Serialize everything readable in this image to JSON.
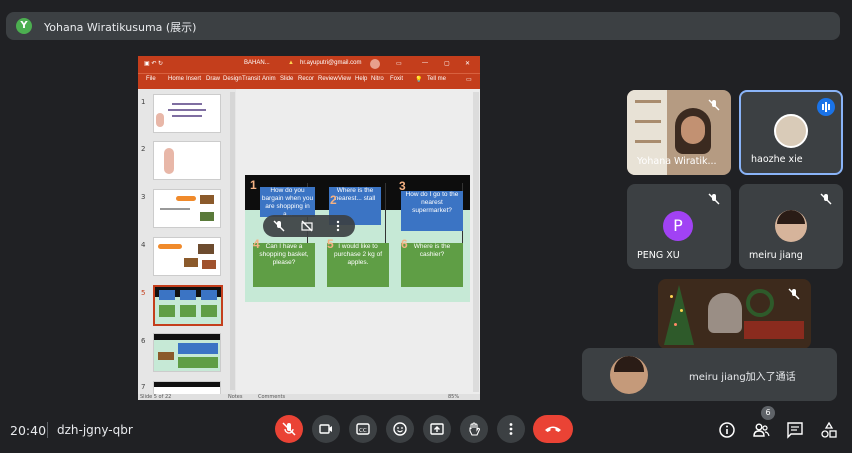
{
  "presenter_bar": {
    "avatar_initial": "Y",
    "name": "Yohana Wiratikusuma (展示)"
  },
  "shared_window": {
    "title_text": "BAHAN...",
    "account": "hr.ayuputri@gmail.com",
    "menu": [
      "File",
      "Home",
      "Insert",
      "Draw",
      "Design",
      "Transit",
      "Anim",
      "Slide",
      "Recor",
      "Review",
      "View",
      "Help",
      "Nitro",
      "Foxit",
      "Tell me"
    ],
    "status_text": "Slide 5 of 22",
    "status_notes": "Notes",
    "status_comments": "Comments",
    "zoom": "85%",
    "thumbnail_numbers": [
      "1",
      "2",
      "3",
      "4",
      "5",
      "6",
      "7"
    ],
    "slide_questions": [
      {
        "num": "1",
        "text": "How do you bargain when you are shopping in a..."
      },
      {
        "num": "2",
        "text": "Where is the nearest... stall"
      },
      {
        "num": "3",
        "text": "How do I go to the nearest supermarket?"
      },
      {
        "num": "4",
        "text": "Can I have a shopping basket, please?"
      },
      {
        "num": "5",
        "text": "I would like to purchase 2 kg of apples."
      },
      {
        "num": "6",
        "text": "Where is the cashier?"
      }
    ]
  },
  "participants": [
    {
      "name": "Yohana Wiratik...",
      "muted": true
    },
    {
      "name": "haozhe xie",
      "speaking": true
    },
    {
      "name": "PENG XU",
      "avatar_initial": "P",
      "muted": true
    },
    {
      "name": "meiru jiang",
      "muted": true
    },
    {
      "name": "",
      "muted": true
    }
  ],
  "toast": {
    "message": "meiru jiang加入了通话"
  },
  "bottom_bar": {
    "time": "20:40",
    "meeting_code": "dzh-jgny-qbr",
    "participant_count": "6"
  },
  "colors": {
    "background": "#202124",
    "end_call": "#ea4335",
    "ppt_brand": "#c43e1c",
    "speaking_border": "#8ab4f8"
  }
}
